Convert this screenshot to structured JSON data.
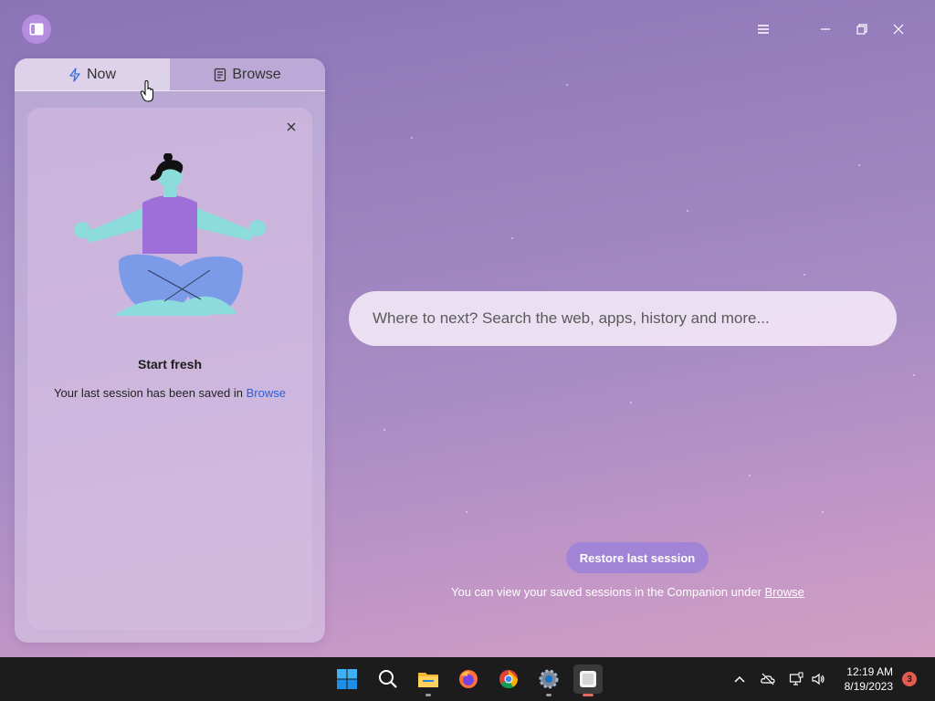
{
  "companion": {
    "tabs": [
      {
        "label": "Now",
        "icon": "lightning-icon",
        "active": true
      },
      {
        "label": "Browse",
        "icon": "document-icon",
        "active": false
      }
    ],
    "card": {
      "title": "Start fresh",
      "text": "Your last session has been saved in ",
      "link": "Browse"
    }
  },
  "search": {
    "placeholder": "Where to next? Search the web, apps, history and more..."
  },
  "restore": {
    "button_label": "Restore last session",
    "note": "You can view your saved sessions in the Companion under ",
    "note_link": "Browse"
  },
  "taskbar": {
    "apps": [
      "windows-start",
      "search",
      "file-explorer",
      "firefox",
      "chrome",
      "settings",
      "arc-browser"
    ],
    "clock_time": "12:19 AM",
    "clock_date": "8/19/2023",
    "notification_count": "3"
  },
  "colors": {
    "accent": "#a184d6",
    "link": "#2b61d9",
    "taskbar": "#1c1c1c"
  }
}
